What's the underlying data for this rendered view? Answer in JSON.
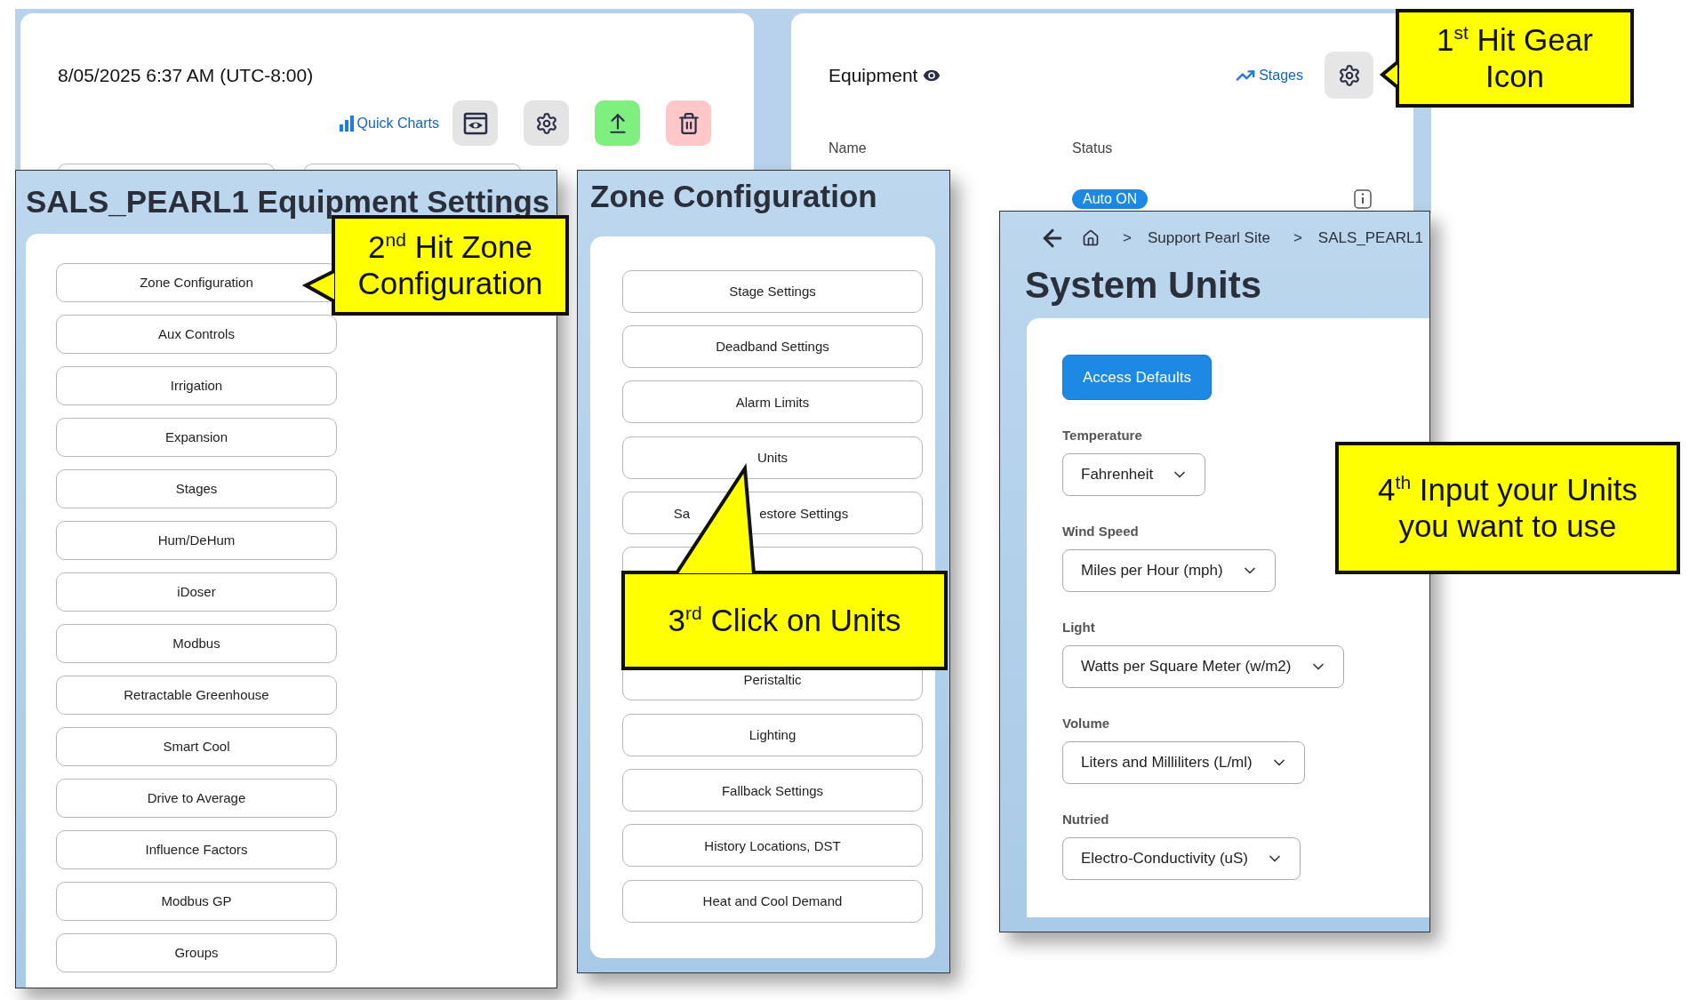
{
  "dashboard_card": {
    "datetime": "8/05/2025 6:37 AM (UTC-8:00)",
    "quick_charts": "Quick Charts",
    "icon_buttons": [
      {
        "kind": "view"
      },
      {
        "kind": "settings"
      },
      {
        "kind": "upload"
      },
      {
        "kind": "delete"
      }
    ]
  },
  "equipment_card": {
    "title": "Equipment",
    "stages_link": "Stages",
    "columns": [
      "Name",
      "Status"
    ],
    "status_badge": "Auto ON"
  },
  "equipment_settings": {
    "title": "SALS_PEARL1 Equipment Settings",
    "buttons": [
      "Zone Configuration",
      "Aux Controls",
      "Irrigation",
      "Expansion",
      "Stages",
      "Hum/DeHum",
      "iDoser",
      "Modbus",
      "Retractable Greenhouse",
      "Smart Cool",
      "Drive to Average",
      "Influence Factors",
      "Modbus GP",
      "Groups"
    ]
  },
  "zone_configuration": {
    "title": "Zone Configuration",
    "buttons": [
      {
        "kind": "labeled",
        "label": "Stage Settings"
      },
      {
        "kind": "labeled",
        "label": "Deadband Settings"
      },
      {
        "kind": "labeled",
        "label": "Alarm Limits"
      },
      {
        "kind": "labeled",
        "label": "Units"
      },
      {
        "kind": "split",
        "label_parts": [
          "Sa",
          "estore Settings"
        ]
      },
      {
        "kind": "covered"
      },
      {
        "kind": "labeled",
        "label": "Peristaltic"
      },
      {
        "kind": "labeled",
        "label": "Lighting"
      },
      {
        "kind": "labeled",
        "label": "Fallback Settings"
      },
      {
        "kind": "labeled",
        "label": "History Locations, DST"
      },
      {
        "kind": "labeled",
        "label": "Heat and Cool Demand"
      }
    ]
  },
  "system_units": {
    "breadcrumb": [
      {
        "separator": ">",
        "label": "Support Pearl Site"
      },
      {
        "separator": ">",
        "label": "SALS_PEARL1"
      }
    ],
    "title": "System Units",
    "action_button": "Access Defaults",
    "fields": [
      {
        "label": "Temperature",
        "value": "Fahrenheit"
      },
      {
        "label": "Wind Speed",
        "value": "Miles per Hour (mph)"
      },
      {
        "label": "Light",
        "value": "Watts per Square Meter (w/m2)"
      },
      {
        "label": "Volume",
        "value": "Liters and Milliliters (L/ml)"
      },
      {
        "label": "Nutried",
        "value": "Electro-Conductivity (uS)"
      }
    ]
  },
  "callouts": [
    {
      "lines": [
        "1$^{st}$ Hit Gear",
        "Icon"
      ]
    },
    {
      "lines": [
        "2$^{nd}$ Hit Zone",
        "Configuration"
      ]
    },
    {
      "lines": [
        "3$^{rd}$ Click on Units"
      ]
    },
    {
      "lines": [
        "4$^{th}$ Input your Units",
        "you want to use"
      ]
    }
  ]
}
